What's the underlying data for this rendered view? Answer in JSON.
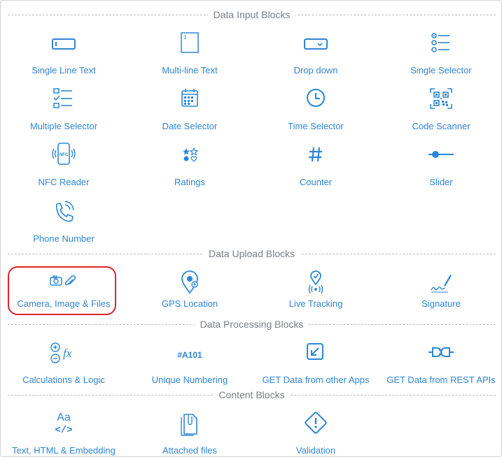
{
  "sections": {
    "input": "Data Input Blocks",
    "upload": "Data Upload Blocks",
    "processing": "Data Processing Blocks",
    "content": "Content Blocks"
  },
  "blocks": {
    "single_line_text": "Single Line Text",
    "multi_line_text": "Multi-line Text",
    "drop_down": "Drop down",
    "single_selector": "Single Selector",
    "multiple_selector": "Multiple Selector",
    "date_selector": "Date Selector",
    "time_selector": "Time Selector",
    "code_scanner": "Code Scanner",
    "nfc_reader": "NFC Reader",
    "ratings": "Ratings",
    "counter": "Counter",
    "slider": "Slider",
    "phone_number": "Phone Number",
    "camera_image_files": "Camera, Image & Files",
    "gps_location": "GPS Location",
    "live_tracking": "Live Tracking",
    "signature": "Signature",
    "calculations_logic": "Calculations & Logic",
    "unique_numbering": "Unique Numbering",
    "get_data_other_apps": "GET Data from other Apps",
    "get_data_rest": "GET Data from REST APIs",
    "text_html_embedding": "Text, HTML & Embedding",
    "attached_files": "Attached files",
    "validation": "Validation"
  },
  "icon_text": {
    "nfc": "NFC",
    "unique_number": "#A101",
    "fx": "fx",
    "aa": "Aa",
    "code": "</>"
  },
  "colors": {
    "accent": "#2e86d6",
    "highlight": "#d9252f",
    "section_text": "#7b8087"
  }
}
